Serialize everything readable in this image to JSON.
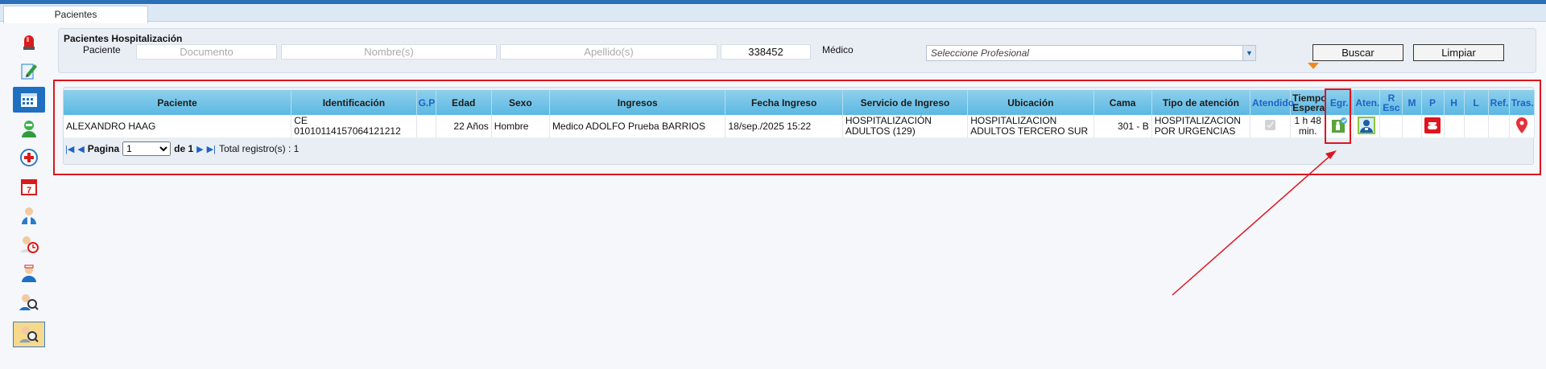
{
  "tab": {
    "label": "Pacientes"
  },
  "filters": {
    "title": "Pacientes Hospitalización",
    "paciente_label": "Paciente",
    "documento_placeholder": "Documento",
    "nombre_placeholder": "Nombre(s)",
    "apellido_placeholder": "Apellido(s)",
    "id_value": "338452",
    "medico_label": "Médico",
    "profesional_placeholder": "Seleccione Profesional",
    "buscar": "Buscar",
    "limpiar": "Limpiar"
  },
  "sidebar_icons": [
    "alarm-icon",
    "edit-icon",
    "calendar-grid-icon",
    "user-green-icon",
    "medical-cross-icon",
    "calendar-7-icon",
    "doctor-icon",
    "clock-user-icon",
    "nurse-icon",
    "search-user-icon",
    "search-user-selected-icon"
  ],
  "table": {
    "headers": {
      "paciente": "Paciente",
      "identificacion": "Identificación",
      "gp": "G.P",
      "edad": "Edad",
      "sexo": "Sexo",
      "ingresos": "Ingresos",
      "fecha_ingreso": "Fecha Ingreso",
      "servicio": "Servicio de Ingreso",
      "ubicacion": "Ubicación",
      "cama": "Cama",
      "tipo_atencion": "Tipo de atención",
      "atendido": "Atendido",
      "tiempo_espera": "Tiempo Espera",
      "egr": "Egr.",
      "aten": "Aten.",
      "r_esc": "R Esc",
      "m": "M",
      "p": "P",
      "h": "H",
      "l": "L",
      "ref": "Ref.",
      "tras": "Tras."
    },
    "row": {
      "paciente": "ALEXANDRO HAAG",
      "identificacion": "CE 01010114157064121212",
      "gp": "",
      "edad": "22 Años",
      "sexo": "Hombre",
      "ingresos": "Medico ADOLFO Prueba BARRIOS",
      "fecha_ingreso": "18/sep./2025 15:22",
      "servicio": "HOSPITALIZACIÓN ADULTOS (129)",
      "ubicacion": "HOSPITALIZACION ADULTOS TERCERO SUR",
      "cama": "301 - B",
      "tipo_atencion": "HOSPITALIZACION POR URGENCIAS",
      "atendido": true,
      "tiempo_espera": "1 h 48 min."
    }
  },
  "pager": {
    "pagina_label": "Pagina",
    "page_value": "1",
    "de_label": "de 1",
    "total": "Total registro(s) : 1"
  },
  "colors": {
    "highlight": "#e0141e",
    "header": "#5bb8e3",
    "accent": "#1e63c4"
  }
}
